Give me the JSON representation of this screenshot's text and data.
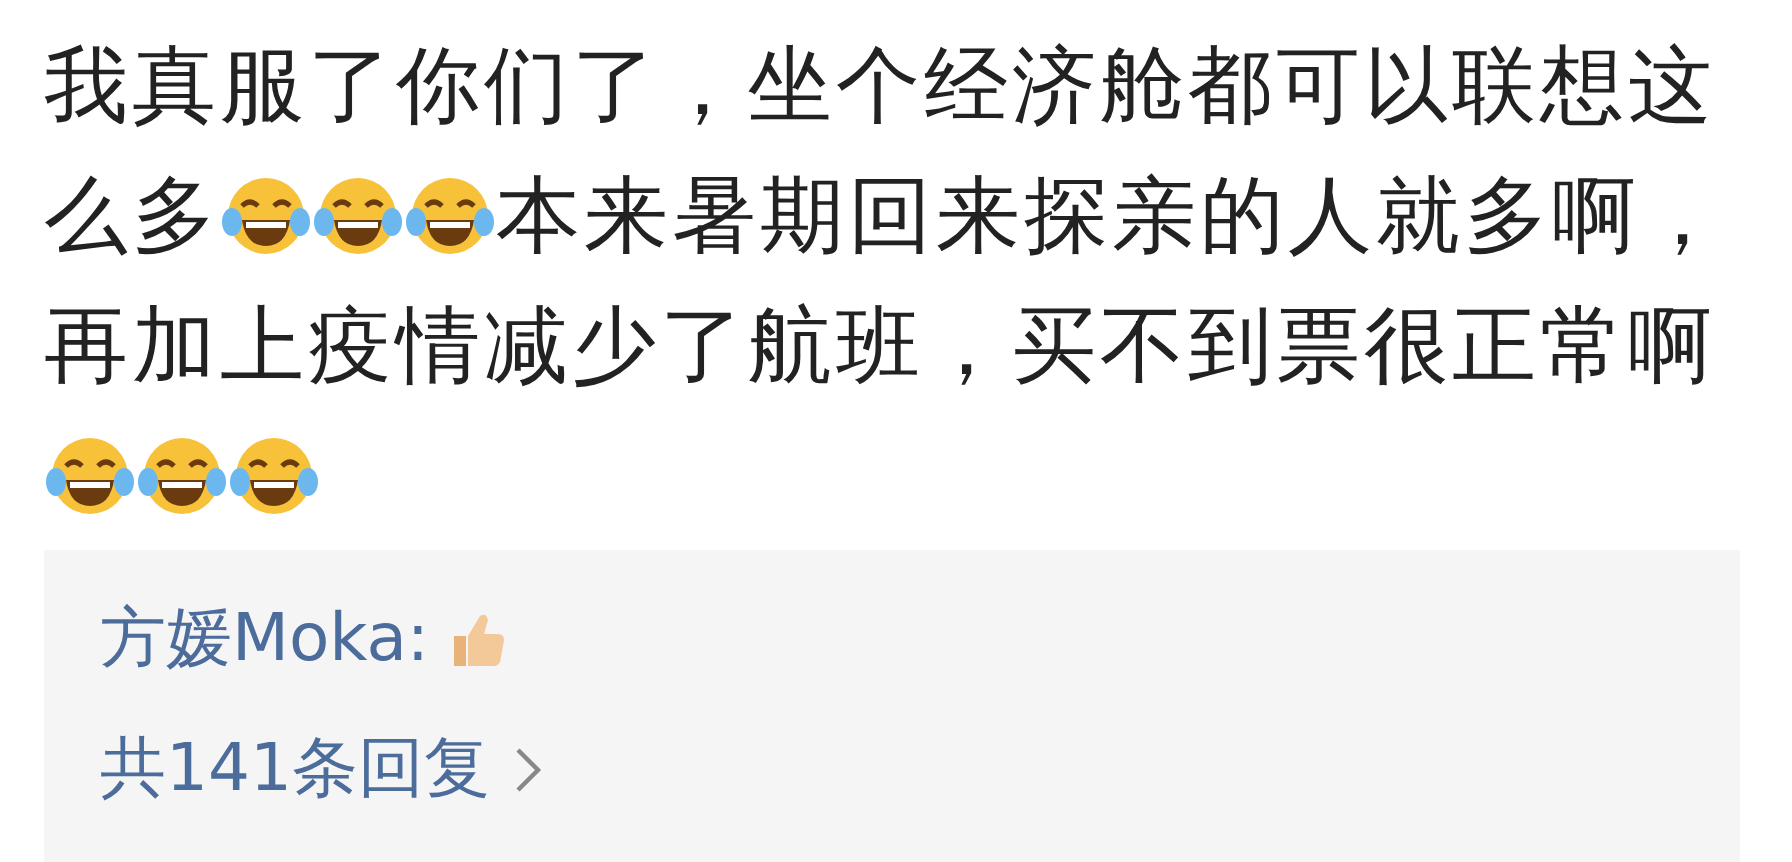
{
  "comment": {
    "lines": [
      [
        {
          "kind": "text",
          "text": "我真服了你们了，坐个经济舱都可以联想这"
        }
      ],
      [
        {
          "kind": "text",
          "text": "么多"
        },
        {
          "kind": "emoji"
        },
        {
          "kind": "emoji"
        },
        {
          "kind": "emoji"
        },
        {
          "kind": "text",
          "text": "本来暑期回来探亲的人就多啊，"
        }
      ],
      [
        {
          "kind": "text",
          "text": "再加上疫情减少了航班，买不到票很正常啊"
        }
      ],
      [
        {
          "kind": "emoji"
        },
        {
          "kind": "emoji"
        },
        {
          "kind": "emoji"
        }
      ]
    ]
  },
  "replies": {
    "author": "方媛Moka:",
    "count": "共141条回复"
  }
}
